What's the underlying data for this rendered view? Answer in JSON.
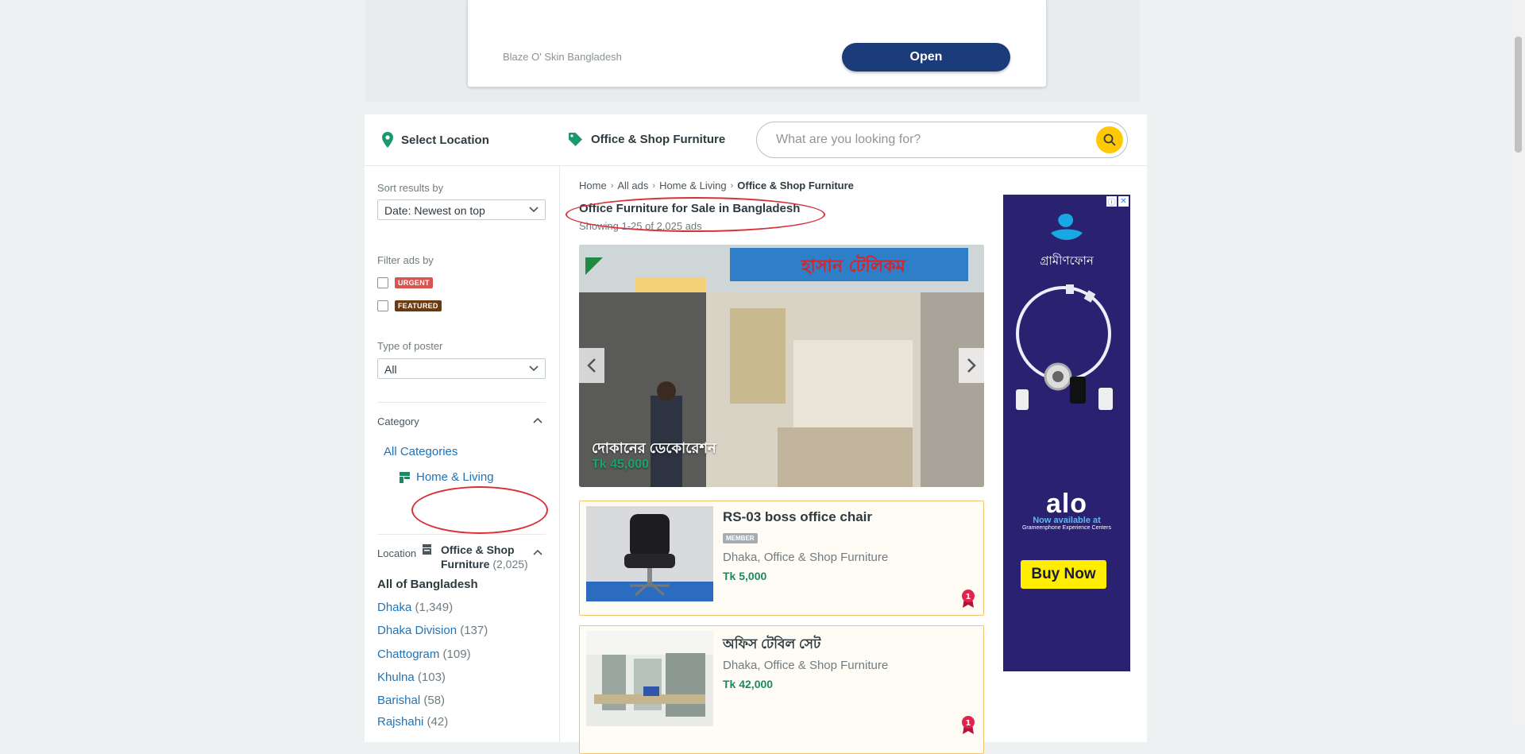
{
  "top_ad": {
    "advertiser": "Blaze O' Skin Bangladesh",
    "button_label": "Open"
  },
  "toolbar": {
    "location_label": "Select Location",
    "category_label": "Office & Shop Furniture",
    "search_placeholder": "What are you looking for?"
  },
  "sidebar": {
    "sort_label": "Sort results by",
    "sort_value": "Date: Newest on top",
    "filter_label": "Filter ads by",
    "urgent_badge": "URGENT",
    "featured_badge": "FEATURED",
    "poster_label": "Type of poster",
    "poster_value": "All",
    "category_heading": "Category",
    "all_categories": "All Categories",
    "home_living": "Home & Living",
    "current_category": "Office & Shop Furniture",
    "current_count": "(2,025)",
    "location_heading": "Location",
    "all_locations": "All of Bangladesh",
    "locations": [
      {
        "name": "Dhaka",
        "count": "(1,349)"
      },
      {
        "name": "Dhaka Division",
        "count": "(137)"
      },
      {
        "name": "Chattogram",
        "count": "(109)"
      },
      {
        "name": "Khulna",
        "count": "(103)"
      },
      {
        "name": "Barishal",
        "count": "(58)"
      },
      {
        "name": "Rajshahi",
        "count": "(42)"
      }
    ]
  },
  "breadcrumb": [
    "Home",
    "All ads",
    "Home & Living",
    "Office & Shop Furniture"
  ],
  "page_title": "Office Furniture for Sale in Bangladesh",
  "showing": "Showing 1-25 of 2,025 ads",
  "featured": {
    "title": "দোকানের ডেকোরেশন",
    "price": "Tk 45,000",
    "sign_text": "হাসান টেলিকম"
  },
  "listings": [
    {
      "title": "RS-03 boss office chair",
      "badge": "MEMBER",
      "location": "Dhaka, Office & Shop Furniture",
      "price": "Tk 5,000",
      "top_ad_number": "1"
    },
    {
      "title": "অফিস টেবিল সেট",
      "location": "Dhaka, Office & Shop Furniture",
      "price": "Tk 42,000",
      "top_ad_number": "1"
    }
  ],
  "side_ad": {
    "brand": "গ্রামীণফোন",
    "product": "alo",
    "avail_line1": "Now available at",
    "avail_line2": "Grameenphone Experience Centers",
    "button": "Buy Now"
  },
  "colors": {
    "accent_teal": "#1a8a63",
    "link_blue": "#1f73b7",
    "search_yellow": "#ffc800",
    "annotation_red": "#d9303a"
  }
}
